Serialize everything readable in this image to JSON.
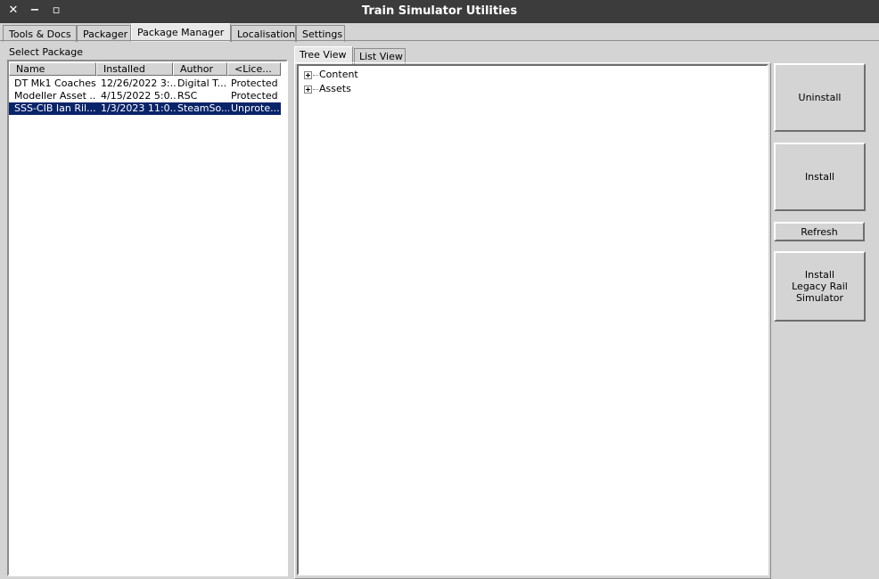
{
  "window": {
    "title": "Train Simulator Utilities",
    "close_glyph": "✕",
    "minimize_glyph": "−",
    "maximize_glyph": "▫"
  },
  "main_tabs": [
    {
      "label": "Tools & Docs",
      "active": false
    },
    {
      "label": "Packager",
      "active": false
    },
    {
      "label": "Package Manager",
      "active": true
    },
    {
      "label": "Localisation",
      "active": false
    },
    {
      "label": "Settings",
      "active": false
    }
  ],
  "package_list": {
    "label": "Select Package",
    "columns": [
      "Name",
      "Installed",
      "Author",
      "<Lice..."
    ],
    "rows": [
      {
        "name": "DT Mk1 Coaches",
        "installed": "12/26/2022 3:...",
        "author": "Digital T...",
        "license": "Protected",
        "selected": false
      },
      {
        "name": "Modeller Asset ...",
        "installed": "4/15/2022 5:0...",
        "author": "RSC",
        "license": "Protected",
        "selected": false
      },
      {
        "name": "SSS-CIB Ian Ril...",
        "installed": "1/3/2023 11:0...",
        "author": "SteamSo...",
        "license": "Unprote...",
        "selected": true
      }
    ]
  },
  "view_tabs": [
    {
      "label": "Tree View",
      "active": true
    },
    {
      "label": "List View",
      "active": false
    }
  ],
  "tree": {
    "nodes": [
      {
        "label": "Content",
        "expander": "plus-icon"
      },
      {
        "label": "Assets",
        "expander": "plus-icon"
      }
    ]
  },
  "actions": {
    "uninstall": "Uninstall",
    "install": "Install",
    "refresh": "Refresh",
    "install_legacy": "Install\nLegacy Rail\nSimulator"
  },
  "colors": {
    "titlebar": "#3c3c3c",
    "selection": "#0a246a",
    "background": "#d4d4d4"
  }
}
